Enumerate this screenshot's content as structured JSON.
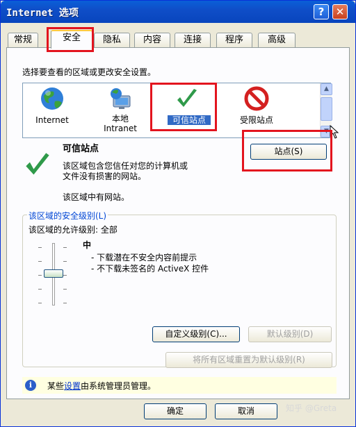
{
  "window": {
    "title": "Internet 选项",
    "help_symbol": "?",
    "close_symbol": "✕"
  },
  "tabs": [
    {
      "label": "常规"
    },
    {
      "label": "安全"
    },
    {
      "label": "隐私"
    },
    {
      "label": "内容"
    },
    {
      "label": "连接"
    },
    {
      "label": "程序"
    },
    {
      "label": "高级"
    }
  ],
  "security": {
    "instruction": "选择要查看的区域或更改安全设置。",
    "zones": [
      {
        "label": "Internet",
        "icon": "globe-icon"
      },
      {
        "label_line1": "本地",
        "label_line2": "Intranet",
        "icon": "intranet-icon"
      },
      {
        "label": "可信站点",
        "icon": "checkmark-icon",
        "selected": true
      },
      {
        "label": "受限站点",
        "icon": "restricted-icon"
      }
    ],
    "zone_title": "可信站点",
    "zone_desc_line1": "该区域包含您信任对您的计算机或",
    "zone_desc_line2": "文件没有损害的网站。",
    "zone_has_sites": "该区域中有网站。",
    "sites_button": "站点(S)",
    "level_group_title": "该区域的安全级别(L)",
    "allowed_level": "该区域的允许级别: 全部",
    "level_name": "中",
    "level_bullet1": "- 下载潜在不安全内容前提示",
    "level_bullet2": "- 不下载未签名的 ActiveX 控件",
    "custom_level_button": "自定义级别(C)...",
    "default_level_button": "默认级别(D)",
    "reset_all_button": "将所有区域重置为默认级别(R)",
    "info_prefix": "某些",
    "info_link": "设置",
    "info_suffix": "由系统管理员管理。"
  },
  "footer": {
    "ok_button": "确定",
    "cancel_button": "取消",
    "watermark": "知乎 @Greta"
  },
  "colors": {
    "highlight_red": "#e3141e",
    "selection_blue": "#316ac5",
    "titlebar_blue": "#0a5fd8",
    "panel_bg": "#fcfcfe",
    "info_bg": "#ffffe1"
  }
}
